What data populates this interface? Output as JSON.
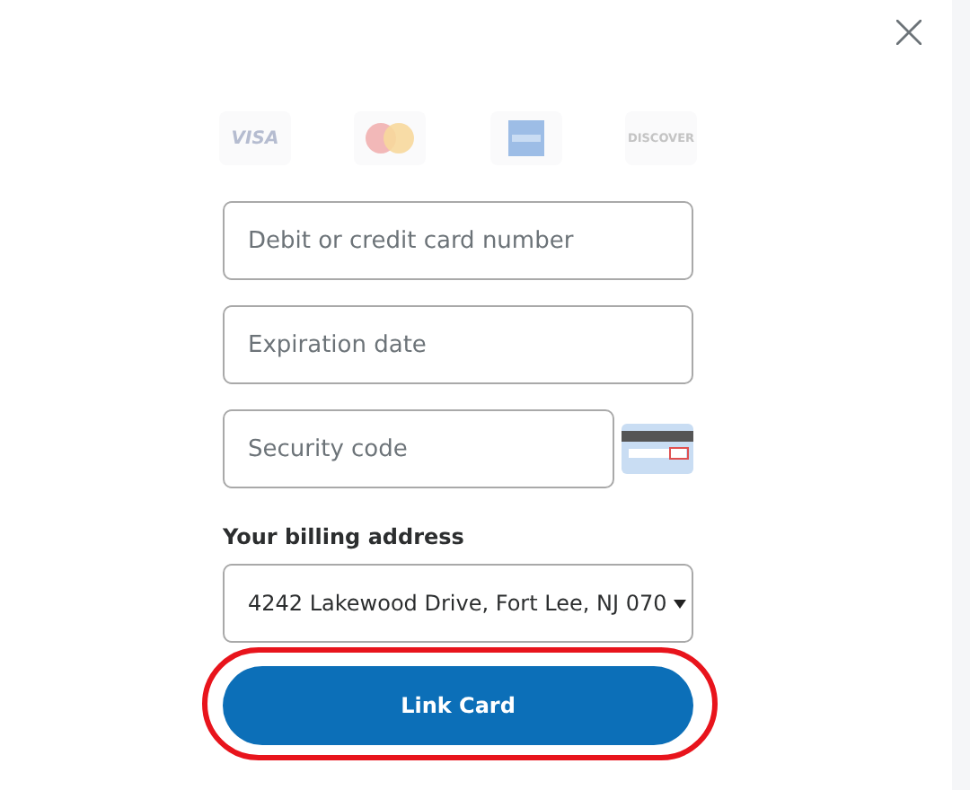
{
  "card_logos": [
    {
      "kind": "visa",
      "label": "VISA"
    },
    {
      "kind": "mastercard"
    },
    {
      "kind": "amex"
    },
    {
      "kind": "discover",
      "label": "DISCOVER"
    }
  ],
  "fields": [
    {
      "placeholder": "Debit or credit card number",
      "kind": "full"
    },
    {
      "placeholder": "Expiration date",
      "kind": "full"
    },
    {
      "placeholder": "Security code",
      "kind": "cvv"
    }
  ],
  "billing": {
    "label": "Your billing address",
    "value": "4242 Lakewood Drive, Fort Lee, NJ 070"
  },
  "submit": {
    "label": "Link Card",
    "highlighted": true
  }
}
